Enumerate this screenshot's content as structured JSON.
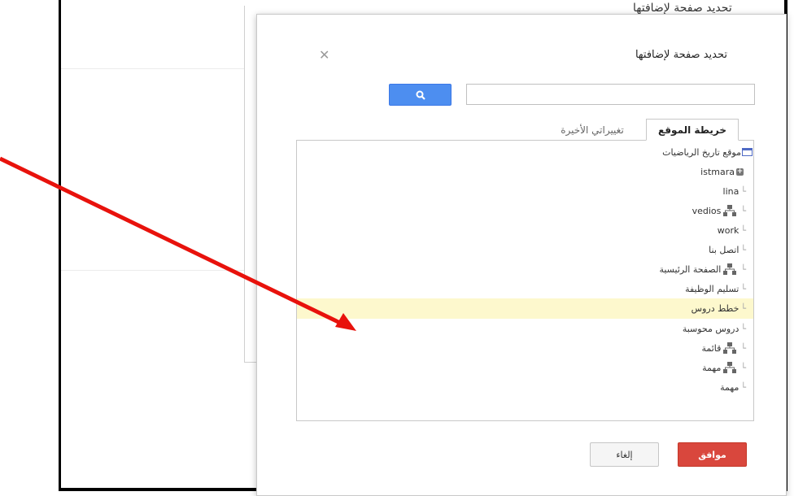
{
  "background": {
    "title": "تحديد صفحة لإضافتها"
  },
  "dialog": {
    "title": "تحديد صفحة لإضافتها",
    "close_icon": "close-icon",
    "search": {
      "value": "",
      "placeholder": "",
      "button_icon": "search-icon"
    },
    "tabs": [
      {
        "label": "خريطة الموقع",
        "active": true
      },
      {
        "label": "تغييراتي الأخيرة",
        "active": false
      }
    ],
    "tree": [
      {
        "label": "موقع تاريخ الرياضيات",
        "icon": "site-icon",
        "selected": false
      },
      {
        "label": "istmara",
        "icon": "plus-icon",
        "selected": false
      },
      {
        "label": "lina",
        "icon": "",
        "selected": false
      },
      {
        "label": "vedios",
        "icon": "sitemap-icon",
        "selected": false
      },
      {
        "label": "work",
        "icon": "",
        "selected": false
      },
      {
        "label": "اتصل بنا",
        "icon": "",
        "selected": false
      },
      {
        "label": "الصفحة الرئيسية",
        "icon": "sitemap-icon",
        "selected": false
      },
      {
        "label": "تسليم الوظيفة",
        "icon": "",
        "selected": false
      },
      {
        "label": "خطط دروس",
        "icon": "",
        "selected": true
      },
      {
        "label": "دروس محوسبة",
        "icon": "",
        "selected": false
      },
      {
        "label": "قائمة",
        "icon": "sitemap-icon",
        "selected": false
      },
      {
        "label": "مهمة",
        "icon": "sitemap-icon",
        "selected": false
      },
      {
        "label": "مهمة",
        "icon": "",
        "selected": false
      }
    ],
    "buttons": {
      "ok": "موافق",
      "cancel": "إلغاء"
    }
  },
  "annotation": {
    "arrow_color": "#e8120c"
  },
  "colors": {
    "ok_button": "#d9473d",
    "search_button": "#4d8ef0",
    "selected_row": "#fdf8cd"
  }
}
